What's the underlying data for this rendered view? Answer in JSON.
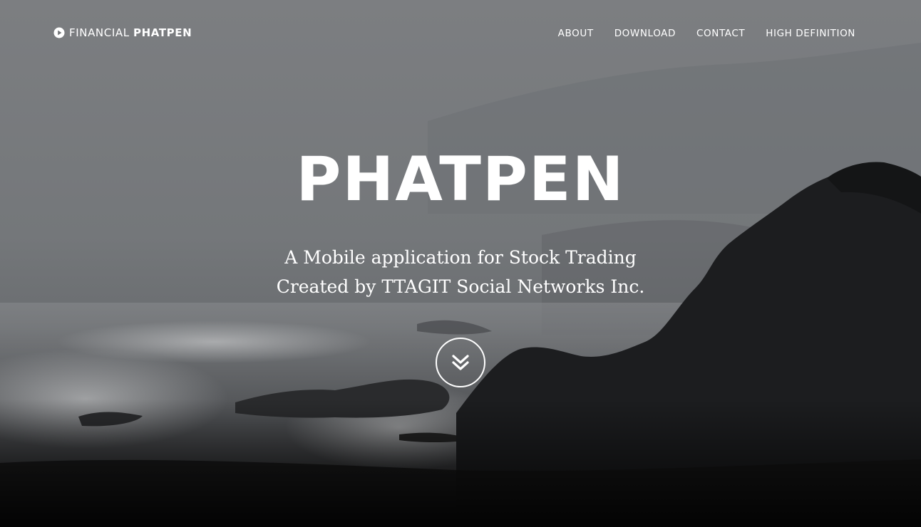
{
  "navbar": {
    "brand": {
      "icon": "play-circle-icon",
      "light_text": "FINANCIAL",
      "bold_text": "PHATPEN"
    },
    "links": [
      {
        "label": "ABOUT"
      },
      {
        "label": "DOWNLOAD"
      },
      {
        "label": "CONTACT"
      },
      {
        "label": "HIGH DEFINITION"
      }
    ]
  },
  "hero": {
    "title": "PHATPEN",
    "subtitle_line1": "A Mobile application for Stock Trading",
    "subtitle_line2": "Created by TTAGIT Social Networks Inc.",
    "scroll_icon": "double-chevron-down-icon"
  },
  "colors": {
    "text": "#ffffff",
    "background_top": "#7b7d80",
    "background_bottom": "#0e0e0e"
  }
}
